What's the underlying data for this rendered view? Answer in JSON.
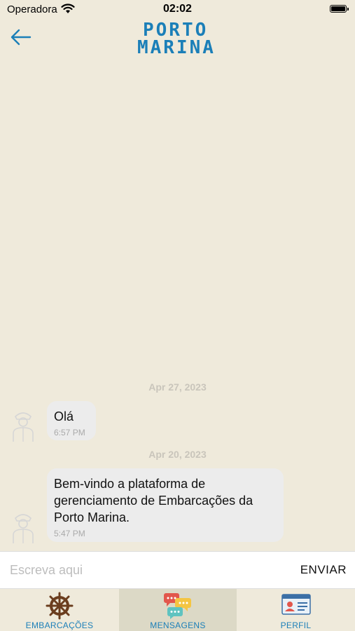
{
  "status_bar": {
    "carrier": "Operadora",
    "time": "02:02"
  },
  "header": {
    "logo_line1": "PORTO",
    "logo_line2": "MARINA"
  },
  "messages": [
    {
      "date": "Apr 27, 2023",
      "lines": [
        "Olá"
      ],
      "time": "6:57 PM"
    },
    {
      "date": "Apr 20, 2023",
      "lines": [
        "Bem-vindo a plataforma de",
        "gerenciamento de Embarcações da",
        "Porto Marina."
      ],
      "time": "5:47 PM"
    }
  ],
  "composer": {
    "placeholder": "Escreva aqui",
    "value": "",
    "send_label": "ENVIAR"
  },
  "tabs": [
    {
      "label": "EMBARCAÇÕES",
      "icon": "ship-wheel-icon",
      "active": false
    },
    {
      "label": "MENSAGENS",
      "icon": "chat-bubbles-icon",
      "active": true
    },
    {
      "label": "PERFIL",
      "icon": "id-card-icon",
      "active": false
    }
  ],
  "colors": {
    "background": "#efeadb",
    "accent": "#1b7fb8",
    "bubble": "#ececec",
    "active_tab": "#dcd9c6"
  }
}
